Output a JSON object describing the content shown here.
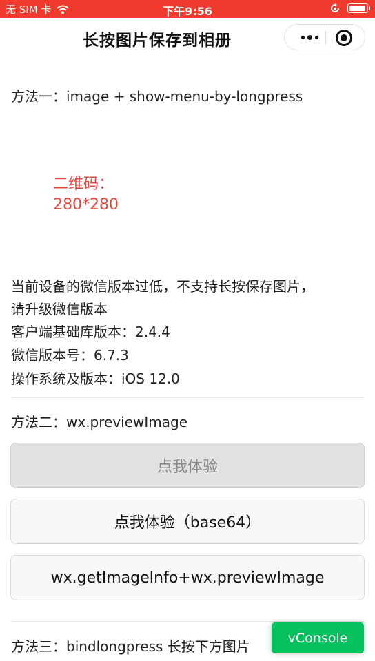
{
  "status": {
    "carrier": "无 SIM 卡",
    "time": "下午9:56"
  },
  "nav": {
    "title": "长按图片保存到相册"
  },
  "method1": {
    "title": "方法一：image + show-menu-by-longpress",
    "qr_line1": "二维码：",
    "qr_line2": "280*280",
    "notice_line1": "当前设备的微信版本过低，不支持长按保存图片，",
    "notice_line2": "请升级微信版本",
    "sdk_version": "客户端基础库版本：2.4.4",
    "wechat_version": "微信版本号：6.7.3",
    "os_version": "操作系统及版本：iOS 12.0"
  },
  "method2": {
    "title": "方法二：wx.previewImage",
    "buttons": [
      "点我体验",
      "点我体验（base64）",
      "wx.getImageInfo+wx.previewImage"
    ]
  },
  "method3": {
    "title": "方法三：bindlongpress 长按下方图片"
  },
  "vconsole_label": "vConsole",
  "colors": {
    "status_bar": "#f03a2d",
    "qr_text": "#e8453c",
    "vconsole": "#07c160"
  }
}
